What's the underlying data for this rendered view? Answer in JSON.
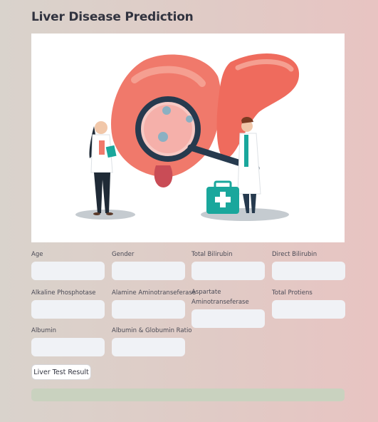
{
  "page": {
    "title": "Liver Disease Prediction"
  },
  "hero_image": {
    "description_icon": "liver-doctors-illustration"
  },
  "form": {
    "fields": {
      "age": {
        "label": "Age",
        "value": ""
      },
      "gender": {
        "label": "Gender",
        "value": ""
      },
      "total_bilirubin": {
        "label": "Total Bilirubin",
        "value": ""
      },
      "direct_bilirubin": {
        "label": "Direct Bilirubin",
        "value": ""
      },
      "alkaline_phosphotase": {
        "label": "Alkaline Phosphotase",
        "value": ""
      },
      "alamine_aminotransferase": {
        "label": "Alamine Aminotranseferase",
        "value": ""
      },
      "aspartate_aminotransferase": {
        "label_line1": "Aspartate",
        "label_line2": "Aminotranseferase",
        "value": ""
      },
      "total_protiens": {
        "label": "Total Protiens",
        "value": ""
      },
      "albumin": {
        "label": "Albumin",
        "value": ""
      },
      "albumin_globumin_ratio": {
        "label": "Albumin & Globumin Ratio",
        "value": ""
      }
    },
    "submit_label": "Liver Test Result"
  },
  "colors": {
    "input_bg": "#f0f2f6",
    "result_bar": "#c9d2bf",
    "liver": "#f0796b",
    "medical_teal": "#1aa79c"
  }
}
